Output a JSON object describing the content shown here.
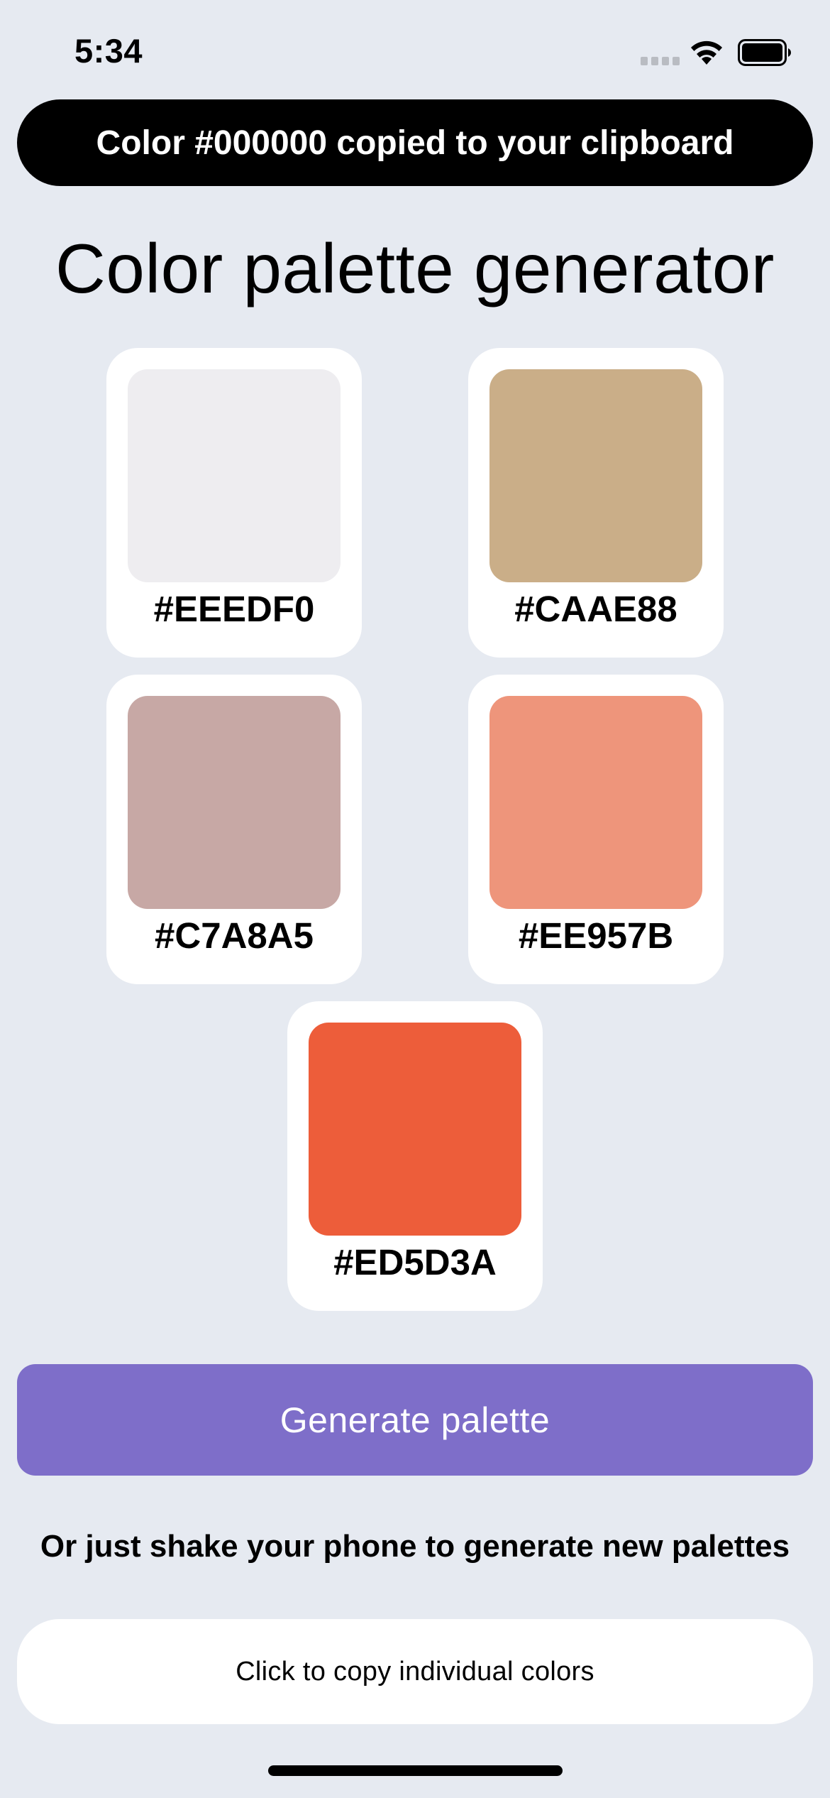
{
  "status_bar": {
    "time": "5:34",
    "icons": [
      "signal-icon",
      "wifi-icon",
      "battery-icon"
    ]
  },
  "toast": {
    "message": "Color #000000 copied to your clipboard"
  },
  "title": "Color palette generator",
  "palette": [
    {
      "hex": "#EEEDF0",
      "color": "#EEEDF0"
    },
    {
      "hex": "#CAAE88",
      "color": "#CAAE88"
    },
    {
      "hex": "#C7A8A5",
      "color": "#C7A8A5"
    },
    {
      "hex": "#EE957B",
      "color": "#EE957B"
    },
    {
      "hex": "#ED5D3A",
      "color": "#ED5D3A"
    }
  ],
  "generate_button": {
    "label": "Generate palette",
    "color": "#7E6EC9"
  },
  "shake_hint": "Or just shake your phone to generate new palettes",
  "copy_hint": "Click to copy individual colors",
  "colors": {
    "background": "#E6EAF1",
    "card": "#FFFFFF",
    "toast": "#000000"
  }
}
